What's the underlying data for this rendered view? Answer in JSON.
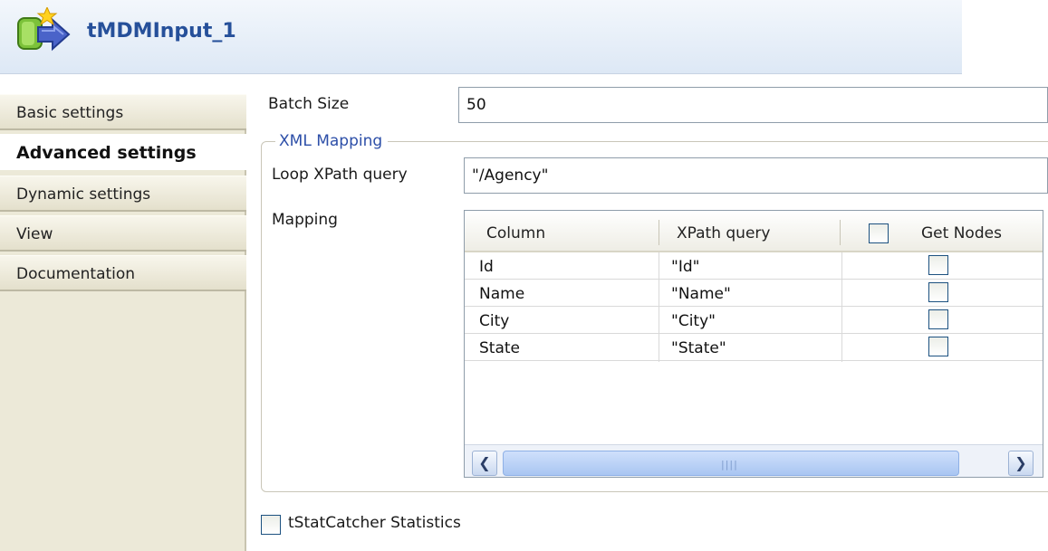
{
  "title": {
    "text": "tMDMInput_1"
  },
  "tabs": [
    {
      "label": "Basic settings",
      "active": false
    },
    {
      "label": "Advanced settings",
      "active": true
    },
    {
      "label": "Dynamic settings",
      "active": false
    },
    {
      "label": "View",
      "active": false
    },
    {
      "label": "Documentation",
      "active": false
    }
  ],
  "form": {
    "batch_size": {
      "label": "Batch Size",
      "value": "50"
    },
    "xml_mapping": {
      "legend": "XML Mapping",
      "loop_xpath": {
        "label": "Loop XPath query",
        "value": "\"/Agency\""
      },
      "mapping": {
        "label": "Mapping",
        "columns": [
          "Column",
          "XPath query",
          "Get Nodes"
        ],
        "header_get_nodes_checked": false,
        "rows": [
          {
            "column": "Id",
            "xpath": "\"Id\"",
            "get_nodes": false
          },
          {
            "column": "Name",
            "xpath": "\"Name\"",
            "get_nodes": false
          },
          {
            "column": "City",
            "xpath": "\"City\"",
            "get_nodes": false
          },
          {
            "column": "State",
            "xpath": "\"State\"",
            "get_nodes": false
          }
        ]
      }
    },
    "tstatcatcher": {
      "label": "tStatCatcher Statistics",
      "checked": false
    }
  },
  "icons": {
    "component": "mdm-input-component-icon",
    "scroll_left": "scroll-left-icon",
    "scroll_right": "scroll-right-icon"
  },
  "colors": {
    "title_text": "#26509a",
    "legend_text": "#2d4fa8",
    "tab_background": "#ece9d8"
  }
}
